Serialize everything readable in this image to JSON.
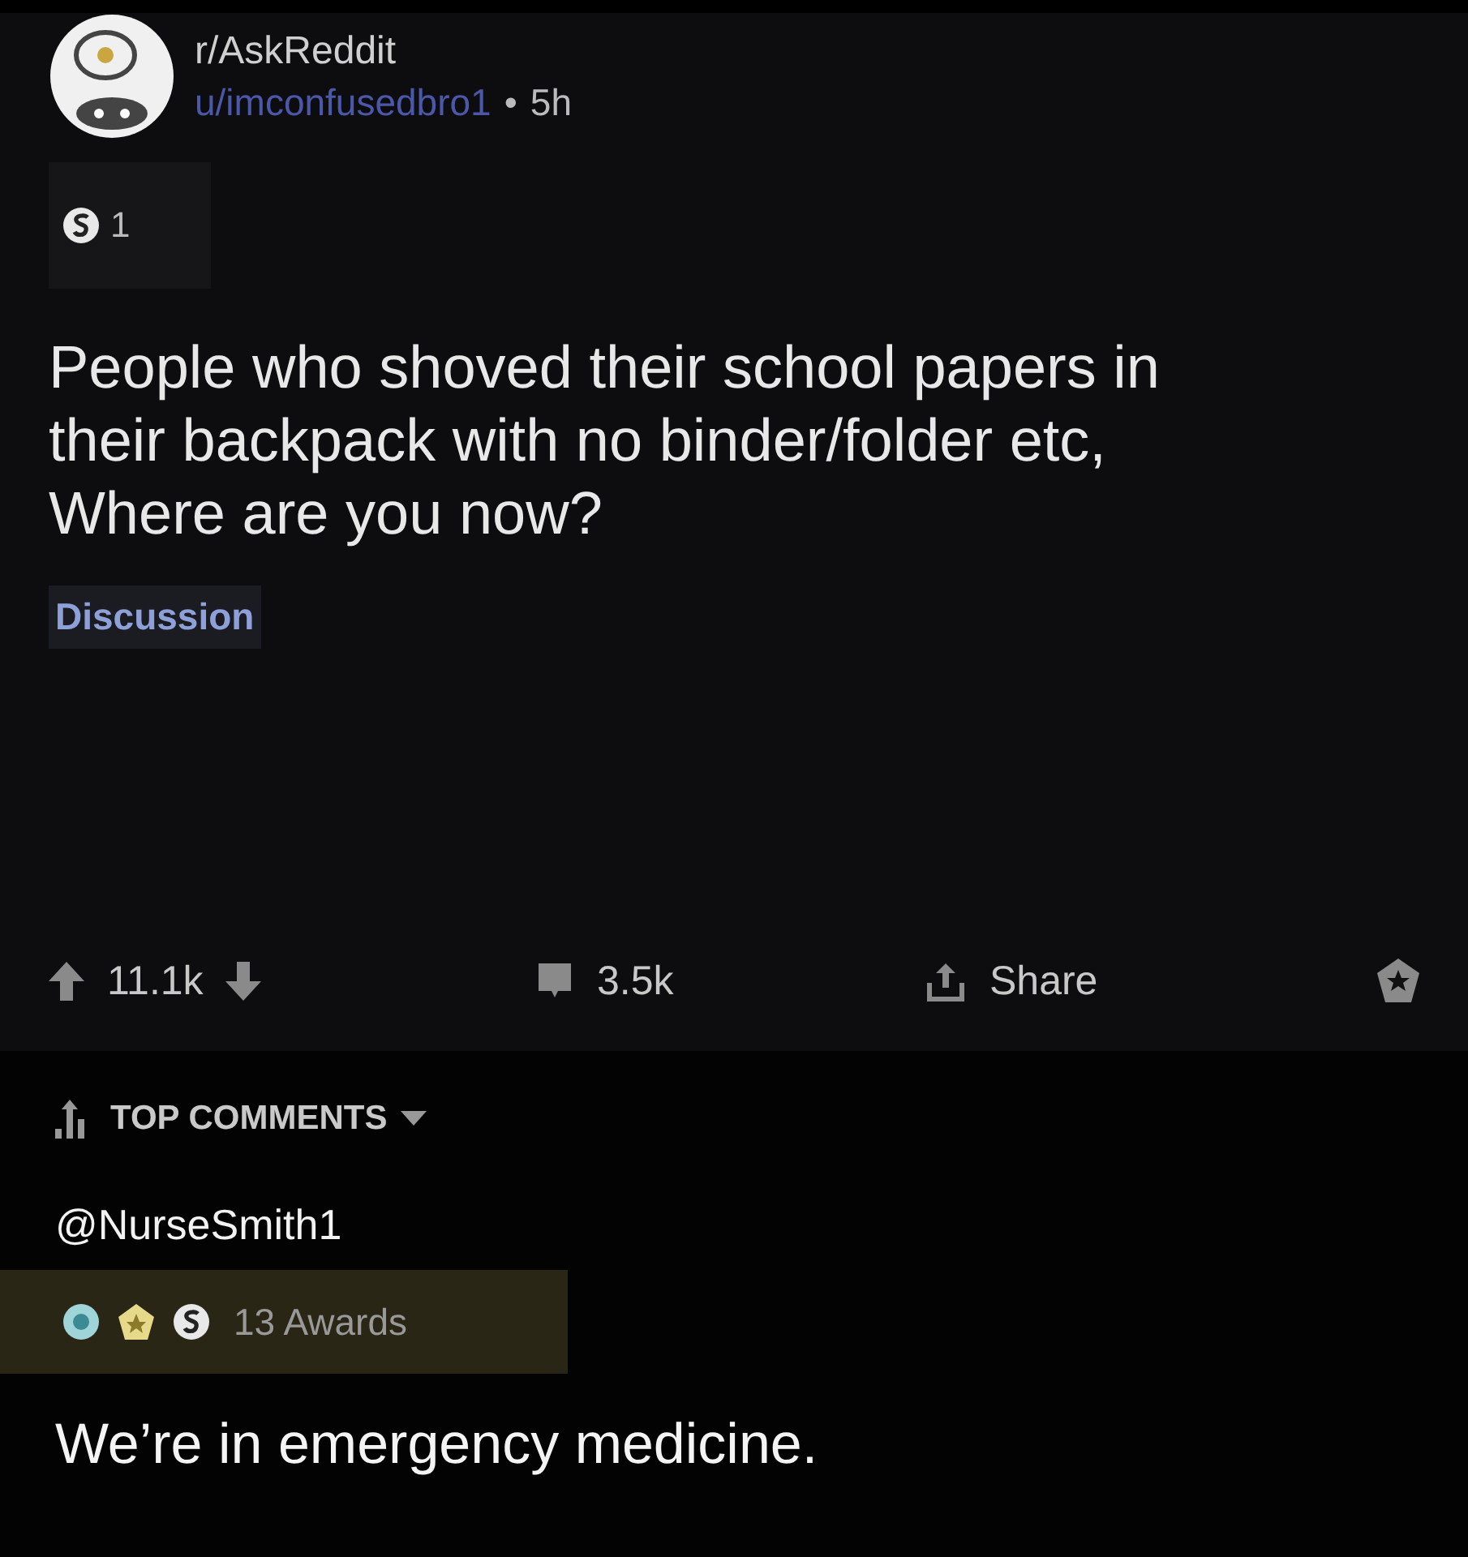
{
  "post": {
    "subreddit": "r/AskReddit",
    "author": "u/imconfusedbro1",
    "separator": "•",
    "age": "5h",
    "award_count": "1",
    "title": "People who shoved their school papers in their backpack with no binder/folder etc, Where are you now?",
    "flair": "Discussion"
  },
  "actions": {
    "score": "11.1k",
    "comments": "3.5k",
    "share": "Share"
  },
  "comments": {
    "sort": "TOP COMMENTS",
    "author": "@NurseSmith1",
    "awards": "13 Awards",
    "body": "We’re in emergency medicine."
  }
}
